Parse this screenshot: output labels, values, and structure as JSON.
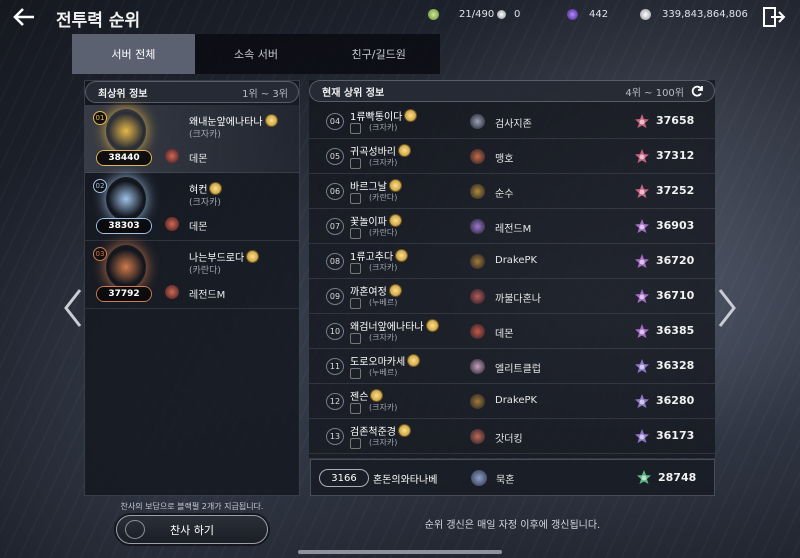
{
  "header": {
    "title": "전투력 순위",
    "currencies": [
      {
        "icon": "stamina-icon",
        "value": "21/490",
        "color": "#8fbf5a"
      },
      {
        "icon": "pearl-icon",
        "value": "0",
        "color": "#c9cbd2"
      },
      {
        "icon": "purple-gem-icon",
        "value": "442",
        "color": "#7a4fd1"
      },
      {
        "icon": "silver-coin-icon",
        "value": "339,843,864,806",
        "color": "#d9dbe2"
      }
    ]
  },
  "tabs": [
    {
      "label": "서버 전체",
      "active": true
    },
    {
      "label": "소속 서버"
    },
    {
      "label": "친구/길드원"
    }
  ],
  "left": {
    "header": "최상위 정보",
    "range": "1위 ~ 3위",
    "top3": [
      {
        "rank": "01",
        "power": "38440",
        "name": "왜내눈앞에나타나",
        "server": "(크자카)",
        "guild": "데몬",
        "tier": "gold",
        "color": "#e7b84a"
      },
      {
        "rank": "02",
        "power": "38303",
        "name": "혀컨",
        "server": "(크자카)",
        "guild": "데몬",
        "tier": "silver",
        "color": "#9fc2ea"
      },
      {
        "rank": "03",
        "power": "37792",
        "name": "나는부드로다",
        "server": "(카란다)",
        "guild": "레전드M",
        "tier": "bronze",
        "color": "#d07a4e"
      }
    ],
    "footer": "찬사의 보답으로 블랙펄 2개가 지급됩니다.",
    "cheer_label": "찬사 하기"
  },
  "right": {
    "header": "현재 상위 정보",
    "range": "4위 ~ 100위",
    "rows": [
      {
        "rank": "04",
        "name": "1류빡통이다",
        "server": "(크자카)",
        "guild": "검사지존",
        "power": "37658",
        "rcolor": "#d86a88"
      },
      {
        "rank": "05",
        "name": "귀곡성바리",
        "server": "(크자카)",
        "guild": "맹호",
        "power": "37312",
        "rcolor": "#d86a88"
      },
      {
        "rank": "06",
        "name": "바르그날",
        "server": "(카란다)",
        "guild": "순수",
        "power": "37252",
        "rcolor": "#d86a88"
      },
      {
        "rank": "07",
        "name": "꽃놀이파",
        "server": "(카란다)",
        "guild": "레전드M",
        "power": "36903",
        "rcolor": "#b274d6"
      },
      {
        "rank": "08",
        "name": "1류고추다",
        "server": "(크자카)",
        "guild": "DrakePK",
        "power": "36720",
        "rcolor": "#b274d6"
      },
      {
        "rank": "09",
        "name": "까혼여정",
        "server": "(누베르)",
        "guild": "까불다혼나",
        "power": "36710",
        "rcolor": "#b274d6"
      },
      {
        "rank": "10",
        "name": "왜검너앞에나타나",
        "server": "(크자카)",
        "guild": "데몬",
        "power": "36385",
        "rcolor": "#b274d6"
      },
      {
        "rank": "11",
        "name": "도로오마카세",
        "server": "(누베르)",
        "guild": "엘리트클럽",
        "power": "36328",
        "rcolor": "#9a80d8"
      },
      {
        "rank": "12",
        "name": "젠슨",
        "server": "(크자카)",
        "guild": "DrakePK",
        "power": "36280",
        "rcolor": "#9a80d8"
      },
      {
        "rank": "13",
        "name": "검존척준경",
        "server": "(크자카)",
        "guild": "갓더킹",
        "power": "36173",
        "rcolor": "#9a80d8"
      }
    ],
    "me": {
      "rank": "3166",
      "name": "혼돈의와타나베",
      "guild": "묵혼",
      "power": "28748",
      "rcolor": "#5fc58a"
    },
    "note": "순위 갱신은 매일 자정 이후에 갱신됩니다."
  }
}
